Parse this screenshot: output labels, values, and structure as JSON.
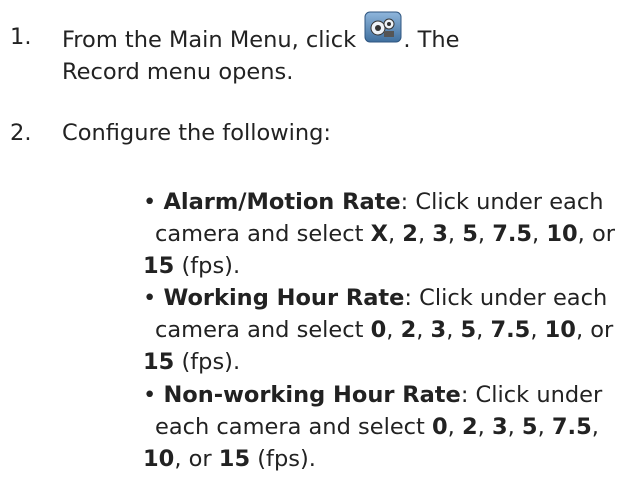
{
  "steps": [
    {
      "number": "1.",
      "line1_before_icon": "From the Main Menu, click",
      "line1_after_icon": ". The",
      "line2": "Record menu opens.",
      "icon": "record-camera-icon"
    },
    {
      "number": "2.",
      "text": "Configure the following:"
    }
  ],
  "items": [
    {
      "bullet": "•",
      "title": "Alarm/Motion Rate",
      "line1_rest": ": Click under each",
      "line2_start": "camera and select ",
      "opt1": "X",
      "sep": ", ",
      "opt2": "2",
      "opt3": "3",
      "opt4": "5",
      "opt5": "7.5",
      "opt6": "10",
      "or": ", or",
      "opt7": "15",
      "unit": " (fps)."
    },
    {
      "bullet": "•",
      "title": "Working Hour Rate",
      "line1_rest": ": Click under each",
      "line2_start": "camera and select ",
      "opt1": "0",
      "sep": ", ",
      "opt2": "2",
      "opt3": "3",
      "opt4": "5",
      "opt5": "7.5",
      "opt6": "10",
      "or": ", or",
      "opt7": "15",
      "unit": " (fps)."
    },
    {
      "bullet": "•",
      "title": "Non-working Hour Rate",
      "line1_rest": ": Click under",
      "line2_start": "each camera and select ",
      "opt1": "0",
      "sep": ", ",
      "opt2": "2",
      "opt3": "3",
      "opt4": "5",
      "opt5": "7.5",
      "comma": ",",
      "opt6": "10",
      "or": ", or ",
      "opt7": "15",
      "unit": " (fps)."
    }
  ],
  "colors": {
    "text": "#222222",
    "icon_bg": "#5b8ab8"
  }
}
